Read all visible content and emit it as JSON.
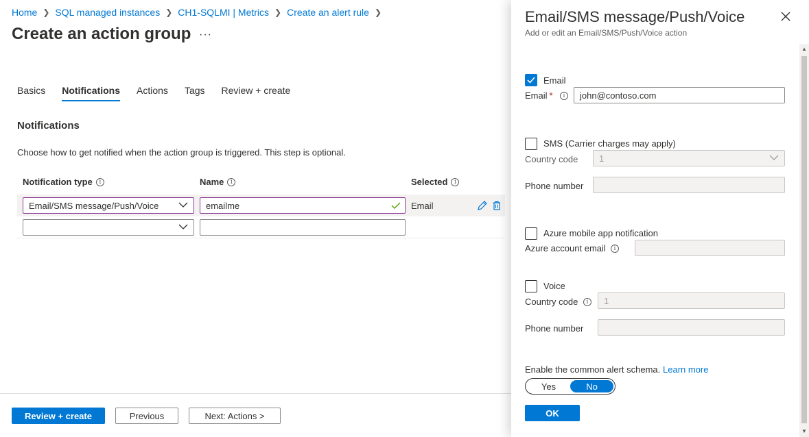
{
  "breadcrumb": [
    "Home",
    "SQL managed instances",
    "CH1-SQLMI | Metrics",
    "Create an alert rule"
  ],
  "page": {
    "title": "Create an action group",
    "more": "···"
  },
  "tabs": [
    {
      "label": "Basics",
      "active": false
    },
    {
      "label": "Notifications",
      "active": true
    },
    {
      "label": "Actions",
      "active": false
    },
    {
      "label": "Tags",
      "active": false
    },
    {
      "label": "Review + create",
      "active": false
    }
  ],
  "notifications": {
    "title": "Notifications",
    "description": "Choose how to get notified when the action group is triggered. This step is optional.",
    "columns": {
      "type": "Notification type",
      "name": "Name",
      "selected": "Selected"
    },
    "rows": [
      {
        "type": "Email/SMS message/Push/Voice",
        "name": "emailme",
        "selected": "Email"
      },
      {
        "type": "",
        "name": "",
        "selected": ""
      }
    ]
  },
  "footer": {
    "review": "Review + create",
    "previous": "Previous",
    "next": "Next: Actions >"
  },
  "panel": {
    "title": "Email/SMS message/Push/Voice",
    "subtitle": "Add or edit an Email/SMS/Push/Voice action",
    "email": {
      "checkbox_label": "Email",
      "checked": true,
      "field_label": "Email",
      "required": "*",
      "value": "john@contoso.com"
    },
    "sms": {
      "checkbox_label": "SMS (Carrier charges may apply)",
      "checked": false,
      "country_label": "Country code",
      "country_value": "1",
      "phone_label": "Phone number",
      "phone_value": ""
    },
    "push": {
      "checkbox_label": "Azure mobile app notification",
      "checked": false,
      "account_label": "Azure account email",
      "account_value": ""
    },
    "voice": {
      "checkbox_label": "Voice",
      "checked": false,
      "country_label": "Country code",
      "country_value": "1",
      "phone_label": "Phone number",
      "phone_value": ""
    },
    "schema": {
      "label": "Enable the common alert schema.",
      "learn_more": "Learn more",
      "yes": "Yes",
      "no": "No",
      "selected": "No"
    },
    "ok": "OK"
  },
  "colors": {
    "accent": "#0078d4",
    "focus_border": "#8e3a97",
    "success": "#57a300",
    "required": "#a4262c"
  },
  "icons": [
    "chevron-right-icon",
    "chevron-down-icon",
    "info-icon",
    "checkmark-icon",
    "edit-pencil-icon",
    "delete-trash-icon",
    "close-icon"
  ]
}
